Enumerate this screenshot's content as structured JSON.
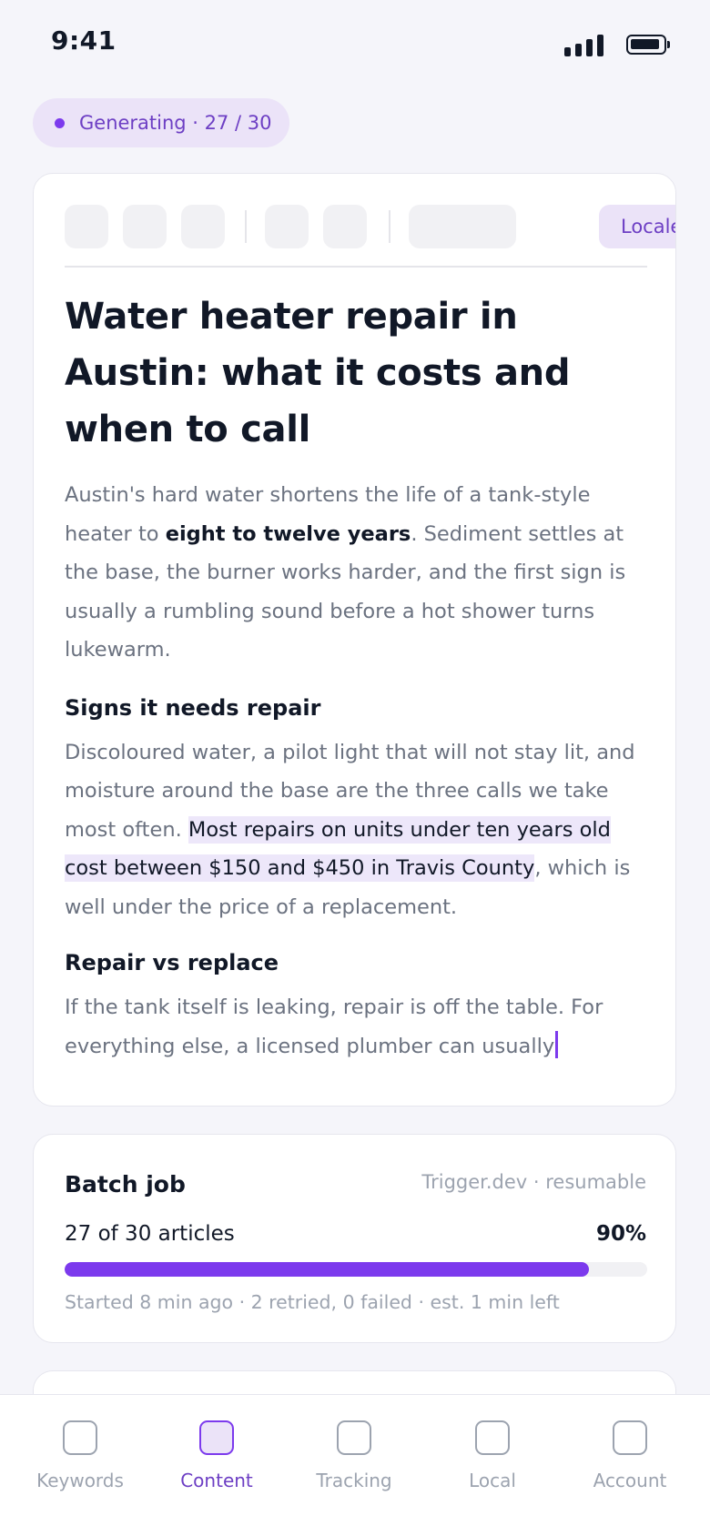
{
  "status_bar": {
    "time": "9:41",
    "signal_icon": "cellular-signal-icon",
    "battery_icon": "battery-icon"
  },
  "generation": {
    "label": "Generating · 27 / 30"
  },
  "editor": {
    "toolbar_buttons": [
      "toolbar-button-1",
      "toolbar-button-2",
      "toolbar-button-3",
      "toolbar-button-4",
      "toolbar-button-5",
      "toolbar-button-6"
    ],
    "locale_label": "Locale: en",
    "title": "Water heater repair in Austin: what it costs and when to call",
    "intro_before": "Austin's hard water shortens the life of a tank-style heater to ",
    "intro_bold": "eight to twelve years",
    "intro_after": ". Sediment settles at the base, the burner works harder, and the first sign is usually a rumbling sound before a hot shower turns lukewarm.",
    "section1_heading": "Signs it needs repair",
    "section1_before": "Discoloured water, a pilot light that will not stay lit, and moisture around the base are the three calls we take most often. ",
    "section1_highlight": "Most repairs on units under ten years old cost between $150 and $450 in Travis County",
    "section1_after": ", which is well under the price of a replacement.",
    "section2_heading": "Repair vs replace",
    "section2_text": "If the tank itself is leaking, repair is off the table. For everything else, a licensed plumber can usually"
  },
  "batch_job": {
    "title": "Batch job",
    "meta": "Trigger.dev · resumable",
    "count_label": "27 of 30 articles",
    "percent_label": "90%",
    "progress": 0.9,
    "status": "Started 8 min ago · 2 retried, 0 failed · est. 1 min left"
  },
  "nav": {
    "items": [
      {
        "label": "Keywords",
        "active": false
      },
      {
        "label": "Content",
        "active": true
      },
      {
        "label": "Tracking",
        "active": false
      },
      {
        "label": "Local",
        "active": false
      },
      {
        "label": "Account",
        "active": false
      }
    ]
  },
  "colors": {
    "accent": "#7c3aed",
    "accent_soft": "#ebe3f8",
    "background": "#f5f5fa",
    "text": "#111827",
    "muted": "#6b7280"
  }
}
